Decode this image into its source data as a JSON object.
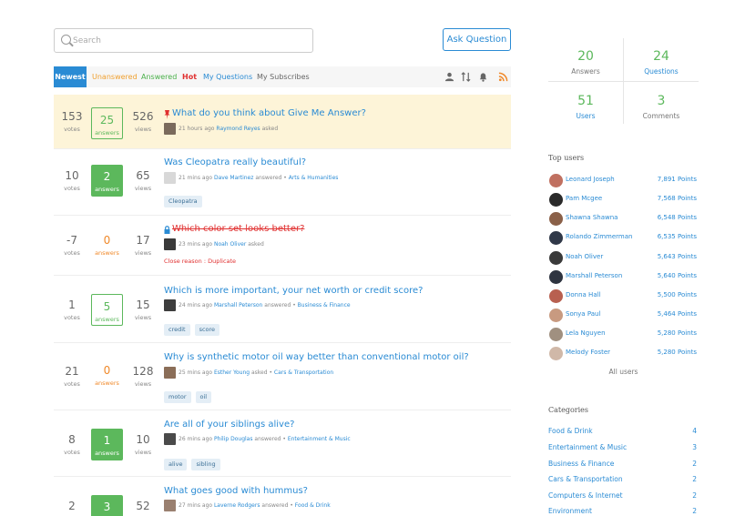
{
  "search": {
    "placeholder": "Search"
  },
  "ask_button": "Ask Question",
  "tabs": {
    "newest": "Newest",
    "unanswered": "Unanswered",
    "answered": "Answered",
    "hot": "Hot",
    "my_questions": "My Questions",
    "my_subscribes": "My Subscribes",
    "icons": [
      "user-icon",
      "sort-icon",
      "bell-icon",
      "rss-icon"
    ]
  },
  "stat_labels": {
    "votes": "votes",
    "answers": "answers",
    "views": "views"
  },
  "questions": [
    {
      "votes": "153",
      "answers": "25",
      "views": "526",
      "title": "What do you think about Give Me Answer?",
      "time": "21 hours ago",
      "user": "Raymond Reyes",
      "action": "asked",
      "category": "",
      "tags": [],
      "reason": ""
    },
    {
      "votes": "10",
      "answers": "2",
      "views": "65",
      "title": "Was Cleopatra really beautiful?",
      "time": "21 mins ago",
      "user": "Dave Martinez",
      "action": "answered",
      "category": "Arts & Humanities",
      "tags": [
        "Cleopatra"
      ],
      "reason": ""
    },
    {
      "votes": "-7",
      "answers": "0",
      "views": "17",
      "title": "Which color set looks better?",
      "time": "23 mins ago",
      "user": "Noah Oliver",
      "action": "asked",
      "category": "",
      "tags": [],
      "reason": "Close reason : Duplicate"
    },
    {
      "votes": "1",
      "answers": "5",
      "views": "15",
      "title": "Which is more important, your net worth or credit score?",
      "time": "24 mins ago",
      "user": "Marshall Peterson",
      "action": "answered",
      "category": "Business & Finance",
      "tags": [
        "credit",
        "score"
      ],
      "reason": ""
    },
    {
      "votes": "21",
      "answers": "0",
      "views": "128",
      "title": "Why is synthetic motor oil way better than conventional motor oil?",
      "time": "25 mins ago",
      "user": "Esther Young",
      "action": "asked",
      "category": "Cars & Transportation",
      "tags": [
        "motor",
        "oil"
      ],
      "reason": ""
    },
    {
      "votes": "8",
      "answers": "1",
      "views": "10",
      "title": "Are all of your siblings alive?",
      "time": "26 mins ago",
      "user": "Philip Douglas",
      "action": "answered",
      "category": "Entertainment & Music",
      "tags": [
        "alive",
        "sibling"
      ],
      "reason": ""
    },
    {
      "votes": "2",
      "answers": "3",
      "views": "52",
      "title": "What goes good with hummus?",
      "time": "27 mins ago",
      "user": "Laverne Rodgers",
      "action": "answered",
      "category": "Food & Drink",
      "tags": [],
      "reason": ""
    }
  ],
  "stats": [
    {
      "value": "20",
      "label": "Answers"
    },
    {
      "value": "24",
      "label": "Questions"
    },
    {
      "value": "51",
      "label": "Users"
    },
    {
      "value": "3",
      "label": "Comments"
    }
  ],
  "top_users": {
    "title": "Top users",
    "users": [
      {
        "name": "Leonard Joseph",
        "points": "7,891 Points"
      },
      {
        "name": "Pam Mcgee",
        "points": "7,568 Points"
      },
      {
        "name": "Shawna Shawna",
        "points": "6,548 Points"
      },
      {
        "name": "Rolando Zimmerman",
        "points": "6,535 Points"
      },
      {
        "name": "Noah Oliver",
        "points": "5,643 Points"
      },
      {
        "name": "Marshall Peterson",
        "points": "5,640 Points"
      },
      {
        "name": "Donna Hall",
        "points": "5,500 Points"
      },
      {
        "name": "Sonya Paul",
        "points": "5,464 Points"
      },
      {
        "name": "Lela Nguyen",
        "points": "5,280 Points"
      },
      {
        "name": "Melody Foster",
        "points": "5,280 Points"
      }
    ],
    "all_users": "All users"
  },
  "categories": {
    "title": "Categories",
    "items": [
      {
        "name": "Food & Drink",
        "count": "4"
      },
      {
        "name": "Entertainment & Music",
        "count": "3"
      },
      {
        "name": "Business & Finance",
        "count": "2"
      },
      {
        "name": "Cars & Transportation",
        "count": "2"
      },
      {
        "name": "Computers & Internet",
        "count": "2"
      },
      {
        "name": "Environment",
        "count": "2"
      }
    ]
  },
  "colors": {
    "accent": "#2a8bd4",
    "green": "#5cb85c",
    "orange": "#f0892a",
    "hot": "#e03030",
    "sticky_bg": "#fdf4d8"
  }
}
